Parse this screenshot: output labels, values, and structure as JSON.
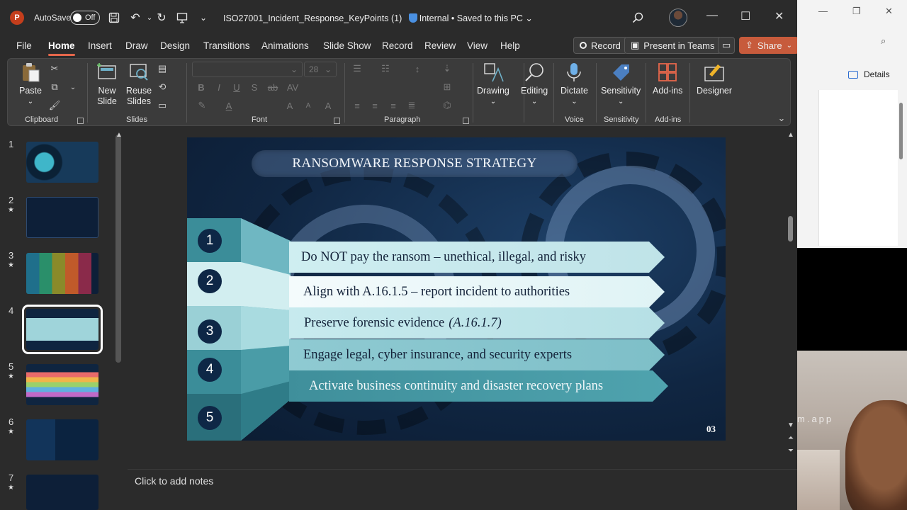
{
  "window": {
    "autosave_label": "AutoSave",
    "autosave_state": "Off",
    "doc_title": "ISO27001_Incident_Response_KeyPoints (1)",
    "sensitivity": "Internal",
    "save_status": "• Saved to this PC"
  },
  "tabs": [
    "File",
    "Home",
    "Insert",
    "Draw",
    "Design",
    "Transitions",
    "Animations",
    "Slide Show",
    "Record",
    "Review",
    "View",
    "Help"
  ],
  "active_tab": "Home",
  "actions": {
    "record": "Record",
    "present": "Present in Teams",
    "share": "Share"
  },
  "ribbon": {
    "clipboard": {
      "paste": "Paste",
      "group": "Clipboard"
    },
    "slides": {
      "new_slide": "New Slide",
      "reuse_slides": "Reuse Slides",
      "group": "Slides"
    },
    "font": {
      "size": "28",
      "group": "Font"
    },
    "paragraph": {
      "group": "Paragraph"
    },
    "drawing": "Drawing",
    "editing": "Editing",
    "voice": {
      "dictate": "Dictate",
      "group": "Voice"
    },
    "sensitivity": {
      "button": "Sensitivity",
      "group": "Sensitivity"
    },
    "addins": {
      "button": "Add-ins",
      "group": "Add-ins"
    },
    "designer": "Designer"
  },
  "thumbnails": [
    {
      "num": "1",
      "star": false
    },
    {
      "num": "2",
      "star": true
    },
    {
      "num": "3",
      "star": true
    },
    {
      "num": "4",
      "star": false,
      "selected": true
    },
    {
      "num": "5",
      "star": true
    },
    {
      "num": "6",
      "star": true
    },
    {
      "num": "7",
      "star": true
    }
  ],
  "slide": {
    "title": "RANSOMWARE RESPONSE STRATEGY",
    "page": "03",
    "items": [
      {
        "num": "1",
        "text": "Do NOT pay the ransom – unethical, illegal, and risky",
        "em": ""
      },
      {
        "num": "2",
        "text": "Align with A.16.1.5 – report incident to authorities",
        "em": ""
      },
      {
        "num": "3",
        "text": "Preserve forensic evidence",
        "em": "(A.16.1.7)"
      },
      {
        "num": "4",
        "text": "Engage legal, cyber insurance, and security experts",
        "em": ""
      },
      {
        "num": "5",
        "text": "Activate business continuity and disaster recovery plans",
        "em": ""
      }
    ]
  },
  "notes_placeholder": "Click to add notes",
  "side_window": {
    "details": "Details"
  },
  "webcam": {
    "watermark": "m.app"
  },
  "colors": {
    "accent": "#e5674b",
    "slide_bg": "#102642",
    "banner": "#bfe3e8",
    "teal": "#3f8f9b"
  }
}
